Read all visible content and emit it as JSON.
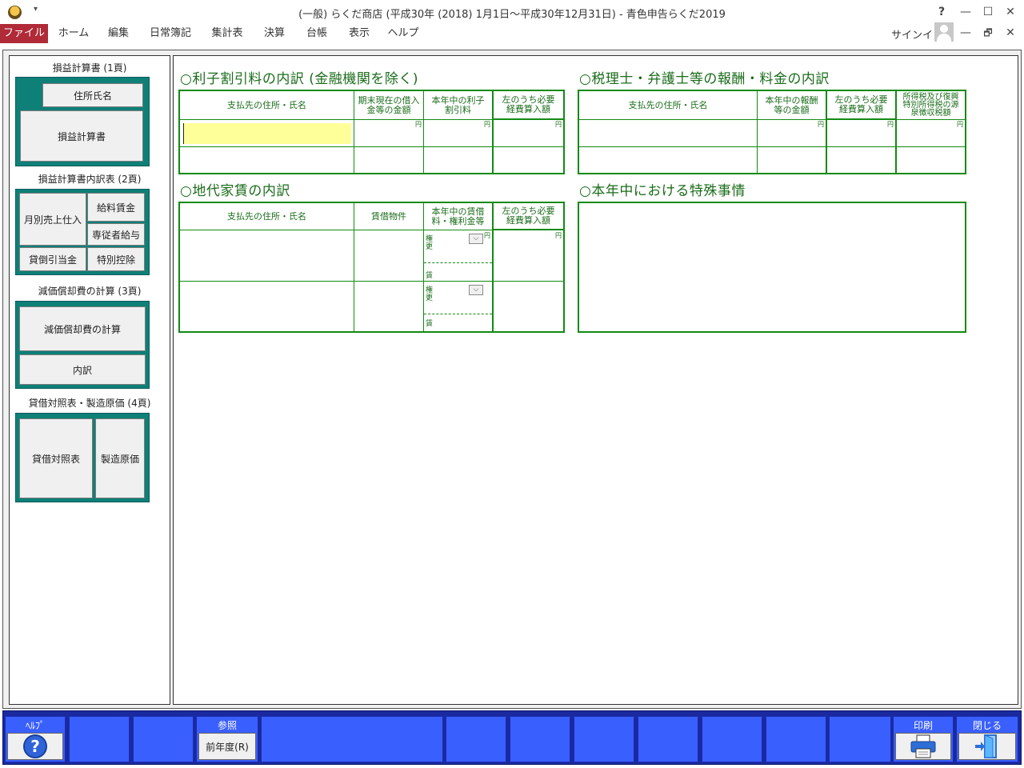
{
  "window": {
    "title": "(一般) らくだ商店 (平成30年 (2018) 1月1日～平成30年12月31日) - 青色申告らくだ2019",
    "help_symbol": "?",
    "minimize_symbol": "—",
    "maximize_symbol": "☐",
    "close_symbol": "✕"
  },
  "menu": {
    "items": [
      "ファイル",
      "ホーム",
      "編集",
      "日常簿記",
      "集計表",
      "決算",
      "台帳",
      "表示",
      "ヘルプ"
    ],
    "signin": "サインイン",
    "ribbon_min": "—",
    "ribbon_restore": "🗗",
    "ribbon_close": "✕"
  },
  "sidebar": {
    "group1_title": "損益計算書 (1頁)",
    "group1_buttons": [
      "住所氏名",
      "損益計算書"
    ],
    "group2_title": "損益計算書内訳表 (2頁)",
    "group2_buttons": [
      "月別売上仕入",
      "給料賃金",
      "専従者給与",
      "貸倒引当金",
      "特別控除"
    ],
    "group3_title": "減価償却費の計算 (3頁)",
    "group3_buttons": [
      "減価償却費の計算",
      "内訳"
    ],
    "group4_title": "貸借対照表・製造原価 (4頁)",
    "group4_buttons": [
      "貸借対照表",
      "製造原価"
    ]
  },
  "interest": {
    "title": "○利子割引料の内訳 (金融機関を除く)",
    "headers": [
      "支払先の住所・氏名",
      "期末現在の借入金等の金額",
      "本年中の利子割引料",
      "左のうち必要経費算入額"
    ],
    "yen": "円"
  },
  "tax_advisor": {
    "title": "○税理士・弁護士等の報酬・料金の内訳",
    "headers": [
      "支払先の住所・氏名",
      "本年中の報酬等の金額",
      "左のうち必要経費算入額",
      "所得税及び復興特別所得税の源泉徴収税額"
    ],
    "yen": "円"
  },
  "rent": {
    "title": "○地代家賃の内訳",
    "headers": [
      "支払先の住所・氏名",
      "賃借物件",
      "本年中の賃借料・権利金等",
      "左のうち必要経費算入額"
    ],
    "kenko_label_1": "権",
    "kenko_label_2": "更",
    "chin_label": "賃",
    "yen": "円"
  },
  "special": {
    "title": "○本年中における特殊事情"
  },
  "toolbar": {
    "help_label": "ﾍﾙﾌﾟ",
    "help_icon": "?",
    "ref_label": "参照",
    "prev_year": "前年度(R)",
    "print_label": "印刷",
    "close_label": "閉じる"
  }
}
